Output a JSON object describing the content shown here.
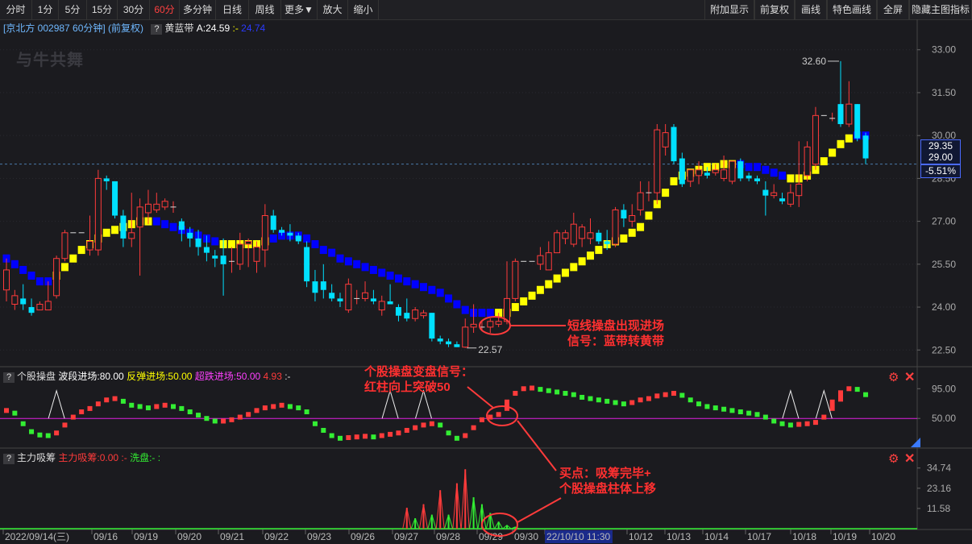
{
  "toolbar": {
    "left_items": [
      "分时",
      "1分",
      "5分",
      "15分",
      "30分",
      "60分",
      "多分钟",
      "日线",
      "周线",
      "更多▼",
      "放大",
      "缩小"
    ],
    "active": "60分",
    "right_items": [
      "附加显示",
      "前复权",
      "画线",
      "特色画线",
      "全屏",
      "隐藏主图指标"
    ]
  },
  "main_legend": {
    "title": "[京北方 002987 60分钟] (前复权)",
    "indicator_name": "黄蓝带",
    "indicator_value": "A:24.59",
    "dash": ":-",
    "value2": "24.74"
  },
  "watermark": "与牛共舞",
  "price_axis": [
    "33.00",
    "31.50",
    "30.00",
    "28.50",
    "27.00",
    "25.50",
    "24.00",
    "22.50"
  ],
  "price_boxes": {
    "current": "29.35",
    "ref": "29.00",
    "pct": "-5.51%"
  },
  "high_label": "32.60",
  "low_label": "22.57",
  "panel2_legend": {
    "name": "个股操盘",
    "l1": "波段进场:80.00",
    "l2": "反弹进场:50.00",
    "l3": "超跌进场:50.00",
    "l4": "4.93",
    "dash": ":-"
  },
  "panel2_axis": [
    "95.00",
    "50.00"
  ],
  "panel3_legend": {
    "name": "主力吸筹",
    "l1": "主力吸筹:0.00",
    "l2": ":-",
    "l3": "洗盘:-",
    "l4": ":"
  },
  "panel3_axis": [
    "34.74",
    "23.16",
    "11.58"
  ],
  "date_axis": [
    "2022/09/14(三)",
    "09/16",
    "09/19",
    "09/20",
    "09/21",
    "09/22",
    "09/23",
    "09/26",
    "09/27",
    "09/28",
    "09/29",
    "09/30",
    "22/10/10 11:30",
    "10/12",
    "10/13",
    "10/14",
    "10/17",
    "10/18",
    "10/19",
    "10/20"
  ],
  "annotations": {
    "a1": [
      "短线操盘出现进场",
      "信号：蓝带转黄带"
    ],
    "a2": [
      "个股操盘变盘信号：",
      "红柱向上突破50"
    ],
    "a3": [
      "买点：吸筹完毕+",
      "个股操盘柱体上移"
    ]
  },
  "colors": {
    "up": "#ff3b3b",
    "down": "#00e0ff",
    "yellow": "#ffff00",
    "blue": "#0000ff",
    "green": "#33ee33",
    "magenta": "#e020e0"
  },
  "chart_data": {
    "type": "candlestick",
    "ylim": [
      22.0,
      33.5
    ],
    "candles": [
      {
        "o": 24.6,
        "h": 25.7,
        "l": 24.2,
        "c": 25.3
      },
      {
        "o": 24.1,
        "h": 24.6,
        "l": 23.9,
        "c": 24.4
      },
      {
        "o": 24.3,
        "h": 24.8,
        "l": 23.9,
        "c": 24.1
      },
      {
        "o": 24.0,
        "h": 24.3,
        "l": 23.7,
        "c": 23.8
      },
      {
        "o": 23.9,
        "h": 24.2,
        "l": 23.9,
        "c": 24.1
      },
      {
        "o": 23.9,
        "h": 24.9,
        "l": 23.9,
        "c": 24.2
      },
      {
        "o": 24.4,
        "h": 25.8,
        "l": 24.3,
        "c": 25.7
      },
      {
        "o": 25.7,
        "h": 26.7,
        "l": 25.6,
        "c": 26.6
      },
      {
        "o": 26.6,
        "h": 26.6,
        "l": 26.6,
        "c": 26.6
      },
      {
        "o": 26.6,
        "h": 26.6,
        "l": 26.6,
        "c": 26.6
      },
      {
        "o": 26.0,
        "h": 27.2,
        "l": 25.8,
        "c": 26.3
      },
      {
        "o": 26.0,
        "h": 28.8,
        "l": 25.8,
        "c": 28.5
      },
      {
        "o": 28.5,
        "h": 28.6,
        "l": 28.1,
        "c": 28.4
      },
      {
        "o": 28.4,
        "h": 28.4,
        "l": 27.1,
        "c": 27.2
      },
      {
        "o": 27.2,
        "h": 27.4,
        "l": 26.1,
        "c": 26.4
      },
      {
        "o": 26.4,
        "h": 28.0,
        "l": 26.1,
        "c": 26.6
      },
      {
        "o": 26.8,
        "h": 27.8,
        "l": 25.1,
        "c": 27.5
      },
      {
        "o": 27.3,
        "h": 28.1,
        "l": 26.9,
        "c": 27.6
      },
      {
        "o": 27.4,
        "h": 28.0,
        "l": 27.3,
        "c": 27.6
      },
      {
        "o": 27.5,
        "h": 27.8,
        "l": 27.4,
        "c": 27.7
      },
      {
        "o": 27.5,
        "h": 27.7,
        "l": 27.3,
        "c": 27.5
      },
      {
        "o": 27.0,
        "h": 27.1,
        "l": 26.3,
        "c": 26.7
      },
      {
        "o": 26.6,
        "h": 26.8,
        "l": 26.1,
        "c": 26.4
      },
      {
        "o": 26.4,
        "h": 26.7,
        "l": 25.8,
        "c": 26.1
      },
      {
        "o": 26.1,
        "h": 26.5,
        "l": 25.6,
        "c": 25.9
      },
      {
        "o": 25.8,
        "h": 26.0,
        "l": 25.4,
        "c": 25.7
      },
      {
        "o": 25.8,
        "h": 26.4,
        "l": 24.4,
        "c": 25.5
      },
      {
        "o": 25.6,
        "h": 26.1,
        "l": 25.2,
        "c": 25.6
      },
      {
        "o": 25.5,
        "h": 26.6,
        "l": 25.3,
        "c": 26.2
      },
      {
        "o": 26.2,
        "h": 26.4,
        "l": 25.4,
        "c": 26.3
      },
      {
        "o": 25.6,
        "h": 26.3,
        "l": 25.2,
        "c": 26.1
      },
      {
        "o": 26.0,
        "h": 27.6,
        "l": 25.4,
        "c": 27.2
      },
      {
        "o": 27.2,
        "h": 27.4,
        "l": 26.6,
        "c": 26.7
      },
      {
        "o": 26.7,
        "h": 26.8,
        "l": 26.5,
        "c": 26.6
      },
      {
        "o": 26.6,
        "h": 26.9,
        "l": 26.3,
        "c": 26.5
      },
      {
        "o": 26.5,
        "h": 26.6,
        "l": 26.2,
        "c": 26.3
      },
      {
        "o": 26.1,
        "h": 26.3,
        "l": 24.7,
        "c": 24.9
      },
      {
        "o": 24.9,
        "h": 25.3,
        "l": 24.2,
        "c": 24.5
      },
      {
        "o": 24.9,
        "h": 25.5,
        "l": 24.3,
        "c": 24.6
      },
      {
        "o": 24.5,
        "h": 24.8,
        "l": 24.2,
        "c": 24.3
      },
      {
        "o": 24.3,
        "h": 24.5,
        "l": 24.0,
        "c": 24.2
      },
      {
        "o": 23.9,
        "h": 25.0,
        "l": 23.8,
        "c": 24.8
      },
      {
        "o": 24.3,
        "h": 24.6,
        "l": 24.1,
        "c": 24.3
      },
      {
        "o": 24.3,
        "h": 24.9,
        "l": 24.2,
        "c": 24.5
      },
      {
        "o": 24.3,
        "h": 24.6,
        "l": 24.1,
        "c": 24.2
      },
      {
        "o": 23.9,
        "h": 24.4,
        "l": 23.7,
        "c": 24.2
      },
      {
        "o": 24.2,
        "h": 24.8,
        "l": 24.1,
        "c": 24.1
      },
      {
        "o": 24.0,
        "h": 24.1,
        "l": 23.5,
        "c": 23.7
      },
      {
        "o": 23.8,
        "h": 24.3,
        "l": 23.5,
        "c": 23.6
      },
      {
        "o": 23.6,
        "h": 24.0,
        "l": 23.5,
        "c": 23.9
      },
      {
        "o": 23.7,
        "h": 23.9,
        "l": 23.6,
        "c": 23.8
      },
      {
        "o": 23.8,
        "h": 23.8,
        "l": 22.8,
        "c": 22.9
      },
      {
        "o": 22.9,
        "h": 23.0,
        "l": 22.7,
        "c": 22.8
      },
      {
        "o": 22.8,
        "h": 22.9,
        "l": 22.6,
        "c": 22.7
      },
      {
        "o": 22.7,
        "h": 22.8,
        "l": 22.6,
        "c": 22.6
      },
      {
        "o": 22.6,
        "h": 23.6,
        "l": 22.57,
        "c": 23.3
      },
      {
        "o": 23.3,
        "h": 24.1,
        "l": 23.1,
        "c": 23.4
      },
      {
        "o": 23.3,
        "h": 23.5,
        "l": 23.2,
        "c": 23.3
      },
      {
        "o": 23.3,
        "h": 23.6,
        "l": 23.1,
        "c": 23.5
      },
      {
        "o": 23.4,
        "h": 23.8,
        "l": 23.3,
        "c": 23.5
      },
      {
        "o": 23.5,
        "h": 25.6,
        "l": 23.4,
        "c": 24.3
      },
      {
        "o": 24.3,
        "h": 25.7,
        "l": 24.2,
        "c": 25.6
      },
      {
        "o": 25.6,
        "h": 25.6,
        "l": 25.6,
        "c": 25.6
      },
      {
        "o": 25.6,
        "h": 25.6,
        "l": 25.6,
        "c": 25.6
      },
      {
        "o": 25.5,
        "h": 26.1,
        "l": 25.3,
        "c": 25.8
      },
      {
        "o": 25.3,
        "h": 26.3,
        "l": 25.3,
        "c": 25.9
      },
      {
        "o": 25.9,
        "h": 26.7,
        "l": 25.9,
        "c": 26.6
      },
      {
        "o": 26.4,
        "h": 26.7,
        "l": 26.2,
        "c": 26.6
      },
      {
        "o": 26.2,
        "h": 27.3,
        "l": 26.1,
        "c": 26.9
      },
      {
        "o": 26.4,
        "h": 26.9,
        "l": 26.1,
        "c": 26.8
      },
      {
        "o": 26.4,
        "h": 27.1,
        "l": 26.2,
        "c": 26.6
      },
      {
        "o": 26.6,
        "h": 26.7,
        "l": 26.2,
        "c": 26.3
      },
      {
        "o": 26.3,
        "h": 26.7,
        "l": 26.0,
        "c": 26.2
      },
      {
        "o": 26.2,
        "h": 27.5,
        "l": 26.1,
        "c": 27.4
      },
      {
        "o": 27.4,
        "h": 27.6,
        "l": 26.8,
        "c": 27.1
      },
      {
        "o": 27.0,
        "h": 27.6,
        "l": 26.8,
        "c": 27.2
      },
      {
        "o": 27.4,
        "h": 28.4,
        "l": 27.2,
        "c": 28.0
      },
      {
        "o": 28.0,
        "h": 28.4,
        "l": 27.7,
        "c": 28.0
      },
      {
        "o": 28.0,
        "h": 30.4,
        "l": 27.6,
        "c": 30.2
      },
      {
        "o": 29.6,
        "h": 30.4,
        "l": 29.3,
        "c": 30.1
      },
      {
        "o": 30.3,
        "h": 30.4,
        "l": 29.0,
        "c": 29.1
      },
      {
        "o": 29.2,
        "h": 29.4,
        "l": 28.2,
        "c": 28.3
      },
      {
        "o": 28.4,
        "h": 28.8,
        "l": 28.2,
        "c": 28.8
      },
      {
        "o": 28.6,
        "h": 29.1,
        "l": 28.3,
        "c": 28.8
      },
      {
        "o": 28.7,
        "h": 28.9,
        "l": 28.5,
        "c": 28.6
      },
      {
        "o": 28.7,
        "h": 29.0,
        "l": 28.6,
        "c": 28.8
      },
      {
        "o": 28.5,
        "h": 29.3,
        "l": 28.4,
        "c": 28.8
      },
      {
        "o": 28.4,
        "h": 29.1,
        "l": 28.3,
        "c": 29.1
      },
      {
        "o": 29.1,
        "h": 29.2,
        "l": 28.4,
        "c": 28.5
      },
      {
        "o": 28.6,
        "h": 28.7,
        "l": 28.4,
        "c": 28.5
      },
      {
        "o": 28.5,
        "h": 28.6,
        "l": 28.3,
        "c": 28.4
      },
      {
        "o": 28.1,
        "h": 28.4,
        "l": 27.2,
        "c": 27.9
      },
      {
        "o": 27.9,
        "h": 28.3,
        "l": 27.8,
        "c": 28.0
      },
      {
        "o": 27.8,
        "h": 28.0,
        "l": 27.6,
        "c": 27.7
      },
      {
        "o": 27.6,
        "h": 28.3,
        "l": 27.5,
        "c": 28.0
      },
      {
        "o": 27.9,
        "h": 29.8,
        "l": 27.5,
        "c": 28.3
      },
      {
        "o": 28.6,
        "h": 29.8,
        "l": 28.4,
        "c": 29.6
      },
      {
        "o": 29.0,
        "h": 31.0,
        "l": 28.8,
        "c": 30.7
      },
      {
        "o": 30.7,
        "h": 30.7,
        "l": 30.7,
        "c": 30.7
      },
      {
        "o": 30.6,
        "h": 30.8,
        "l": 30.5,
        "c": 30.6
      },
      {
        "o": 31.1,
        "h": 32.6,
        "l": 30.3,
        "c": 30.4
      },
      {
        "o": 30.4,
        "h": 31.9,
        "l": 30.3,
        "c": 31.1
      },
      {
        "o": 31.1,
        "h": 31.1,
        "l": 29.8,
        "c": 29.9
      },
      {
        "o": 30.0,
        "h": 30.1,
        "l": 29.0,
        "c": 29.2
      }
    ],
    "band": [
      25.7,
      25.5,
      25.3,
      25.1,
      24.9,
      24.9,
      25.1,
      25.4,
      25.7,
      26.0,
      26.2,
      26.4,
      26.6,
      26.7,
      26.8,
      26.9,
      27.0,
      27.0,
      27.0,
      26.9,
      26.8,
      26.7,
      26.6,
      26.5,
      26.4,
      26.3,
      26.2,
      26.2,
      26.2,
      26.2,
      26.2,
      26.3,
      26.4,
      26.5,
      26.5,
      26.5,
      26.4,
      26.2,
      26.0,
      25.9,
      25.7,
      25.6,
      25.5,
      25.4,
      25.3,
      25.2,
      25.1,
      25.0,
      24.9,
      24.8,
      24.7,
      24.6,
      24.5,
      24.3,
      24.1,
      23.9,
      23.8,
      23.8,
      23.8,
      23.8,
      23.8,
      24.0,
      24.2,
      24.4,
      24.6,
      24.8,
      25.0,
      25.2,
      25.4,
      25.6,
      25.8,
      26.0,
      26.2,
      26.3,
      26.4,
      26.6,
      26.8,
      27.2,
      27.6,
      28.0,
      28.4,
      28.6,
      28.7,
      28.8,
      28.9,
      28.9,
      29.0,
      29.0,
      29.0,
      28.9,
      28.9,
      28.8,
      28.7,
      28.6,
      28.5,
      28.5,
      28.6,
      28.8,
      29.1,
      29.4,
      29.7,
      29.9,
      30.0,
      30.0
    ],
    "band_colors": "BBBBBBYYYYYYYYYYYYBBBBBBBBYYYYYYBBBBBBBBBBBBBBBBBBBBBBBBBBBYYYYYYYYYYYYYYYYYYYYYYYYYYYYYBBBBBBYYYYYYYY",
    "oscillator": [
      62,
      58,
      42,
      30,
      25,
      24,
      28,
      40,
      52,
      60,
      65,
      72,
      78,
      80,
      76,
      70,
      68,
      66,
      68,
      70,
      68,
      65,
      60,
      55,
      50,
      46,
      46,
      48,
      52,
      56,
      62,
      66,
      68,
      70,
      68,
      66,
      60,
      42,
      32,
      24,
      20,
      21,
      22,
      23,
      22,
      24,
      26,
      28,
      32,
      36,
      40,
      42,
      40,
      28,
      20,
      24,
      36,
      48,
      52,
      56,
      70,
      88,
      95,
      96,
      94,
      92,
      90,
      88,
      86,
      82,
      80,
      78,
      76,
      74,
      72,
      74,
      78,
      80,
      84,
      86,
      88,
      85,
      78,
      72,
      68,
      66,
      64,
      62,
      60,
      58,
      56,
      52,
      46,
      42,
      40,
      41,
      42,
      44,
      52,
      70,
      84,
      95,
      94,
      86,
      70,
      58
    ]
  }
}
